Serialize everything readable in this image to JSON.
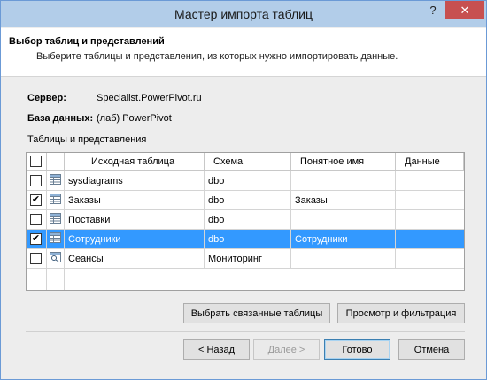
{
  "window": {
    "title": "Мастер импорта таблиц",
    "help_glyph": "?",
    "close_glyph": "✕"
  },
  "header": {
    "title": "Выбор таблиц и представлений",
    "description": "Выберите таблицы и представления, из которых нужно импортировать данные."
  },
  "connection": {
    "server_label": "Сервер:",
    "server_value": "Specialist.PowerPivot.ru",
    "database_label": "База данных:",
    "database_value": "(лаб) PowerPivot"
  },
  "tables": {
    "section_label": "Таблицы и представления",
    "columns": [
      "Исходная таблица",
      "Схема",
      "Понятное имя",
      "Данные"
    ],
    "rows": [
      {
        "checked": false,
        "icon": "table-icon",
        "source": "sysdiagrams",
        "schema": "dbo",
        "friendly": "",
        "data": "",
        "selected": false
      },
      {
        "checked": true,
        "icon": "table-icon",
        "source": "Заказы",
        "schema": "dbo",
        "friendly": "Заказы",
        "data": "",
        "selected": false
      },
      {
        "checked": false,
        "icon": "table-icon",
        "source": "Поставки",
        "schema": "dbo",
        "friendly": "",
        "data": "",
        "selected": false
      },
      {
        "checked": true,
        "icon": "table-icon",
        "source": "Сотрудники",
        "schema": "dbo",
        "friendly": "Сотрудники",
        "data": "",
        "selected": true
      },
      {
        "checked": false,
        "icon": "view-icon",
        "source": "Сеансы",
        "schema": "Мониторинг",
        "friendly": "",
        "data": "",
        "selected": false
      }
    ]
  },
  "buttons": {
    "select_related": "Выбрать связанные таблицы",
    "preview_filter": "Просмотр и фильтрация",
    "back": "< Назад",
    "next": "Далее >",
    "finish": "Готово",
    "cancel": "Отмена"
  },
  "check_glyph": "✔",
  "colors": {
    "selection": "#3399ff",
    "titlebar": "#b2cde9",
    "close_button": "#c75050"
  }
}
